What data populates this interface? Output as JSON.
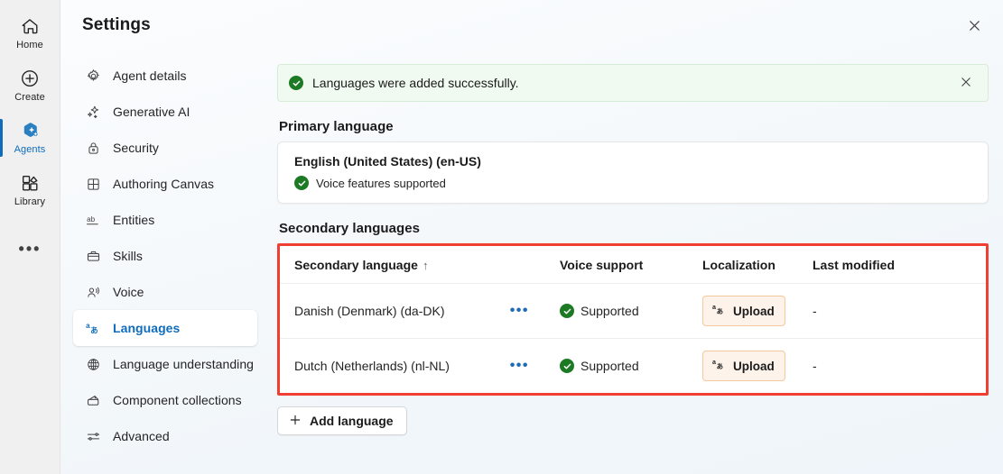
{
  "app_rail": {
    "items": [
      {
        "label": "Home",
        "icon": "home-icon",
        "active": false
      },
      {
        "label": "Create",
        "icon": "plus-circle-icon",
        "active": false
      },
      {
        "label": "Agents",
        "icon": "agents-icon",
        "active": true
      },
      {
        "label": "Library",
        "icon": "library-icon",
        "active": false
      }
    ],
    "more_label": "•••",
    "more_icon": "more-horizontal-icon"
  },
  "panel": {
    "title": "Settings",
    "close_icon": "close-icon"
  },
  "nav": {
    "items": [
      {
        "label": "Agent details",
        "icon": "gear-icon",
        "active": false
      },
      {
        "label": "Generative AI",
        "icon": "sparkle-icon",
        "active": false
      },
      {
        "label": "Security",
        "icon": "lock-icon",
        "active": false
      },
      {
        "label": "Authoring Canvas",
        "icon": "canvas-grid-icon",
        "active": false
      },
      {
        "label": "Entities",
        "icon": "ab-text-icon",
        "active": false
      },
      {
        "label": "Skills",
        "icon": "briefcase-icon",
        "active": false
      },
      {
        "label": "Voice",
        "icon": "voice-person-icon",
        "active": false
      },
      {
        "label": "Languages",
        "icon": "local-language-icon",
        "active": true
      },
      {
        "label": "Language understanding",
        "icon": "globe-brain-icon",
        "active": false
      },
      {
        "label": "Component collections",
        "icon": "collections-icon",
        "active": false
      },
      {
        "label": "Advanced",
        "icon": "sliders-icon",
        "active": false
      }
    ]
  },
  "banner": {
    "message": "Languages were added successfully.",
    "status_icon": "success-check-icon",
    "close_icon": "close-icon",
    "background": "#f1faf1",
    "accent": "#1d7a24"
  },
  "primary": {
    "heading": "Primary language",
    "language": "English (United States) (en-US)",
    "voice_status": "Voice features supported",
    "voice_icon": "success-check-icon"
  },
  "secondary": {
    "heading": "Secondary languages",
    "highlight_color": "#f03f32",
    "columns": [
      {
        "label": "Secondary language",
        "sort": "↑"
      },
      {
        "label": "Voice support",
        "sort": ""
      },
      {
        "label": "Localization",
        "sort": ""
      },
      {
        "label": "Last modified",
        "sort": ""
      }
    ],
    "rows": [
      {
        "language": "Danish (Denmark) (da-DK)",
        "more_label": "•••",
        "voice_support": "Supported",
        "voice_icon": "success-check-icon",
        "localization_label": "Upload",
        "localization_icon": "local-language-icon",
        "last_modified": "-"
      },
      {
        "language": "Dutch (Netherlands) (nl-NL)",
        "more_label": "•••",
        "voice_support": "Supported",
        "voice_icon": "success-check-icon",
        "localization_label": "Upload",
        "localization_icon": "local-language-icon",
        "last_modified": "-"
      }
    ],
    "add_button_label": "Add language",
    "add_button_icon": "plus-icon"
  }
}
